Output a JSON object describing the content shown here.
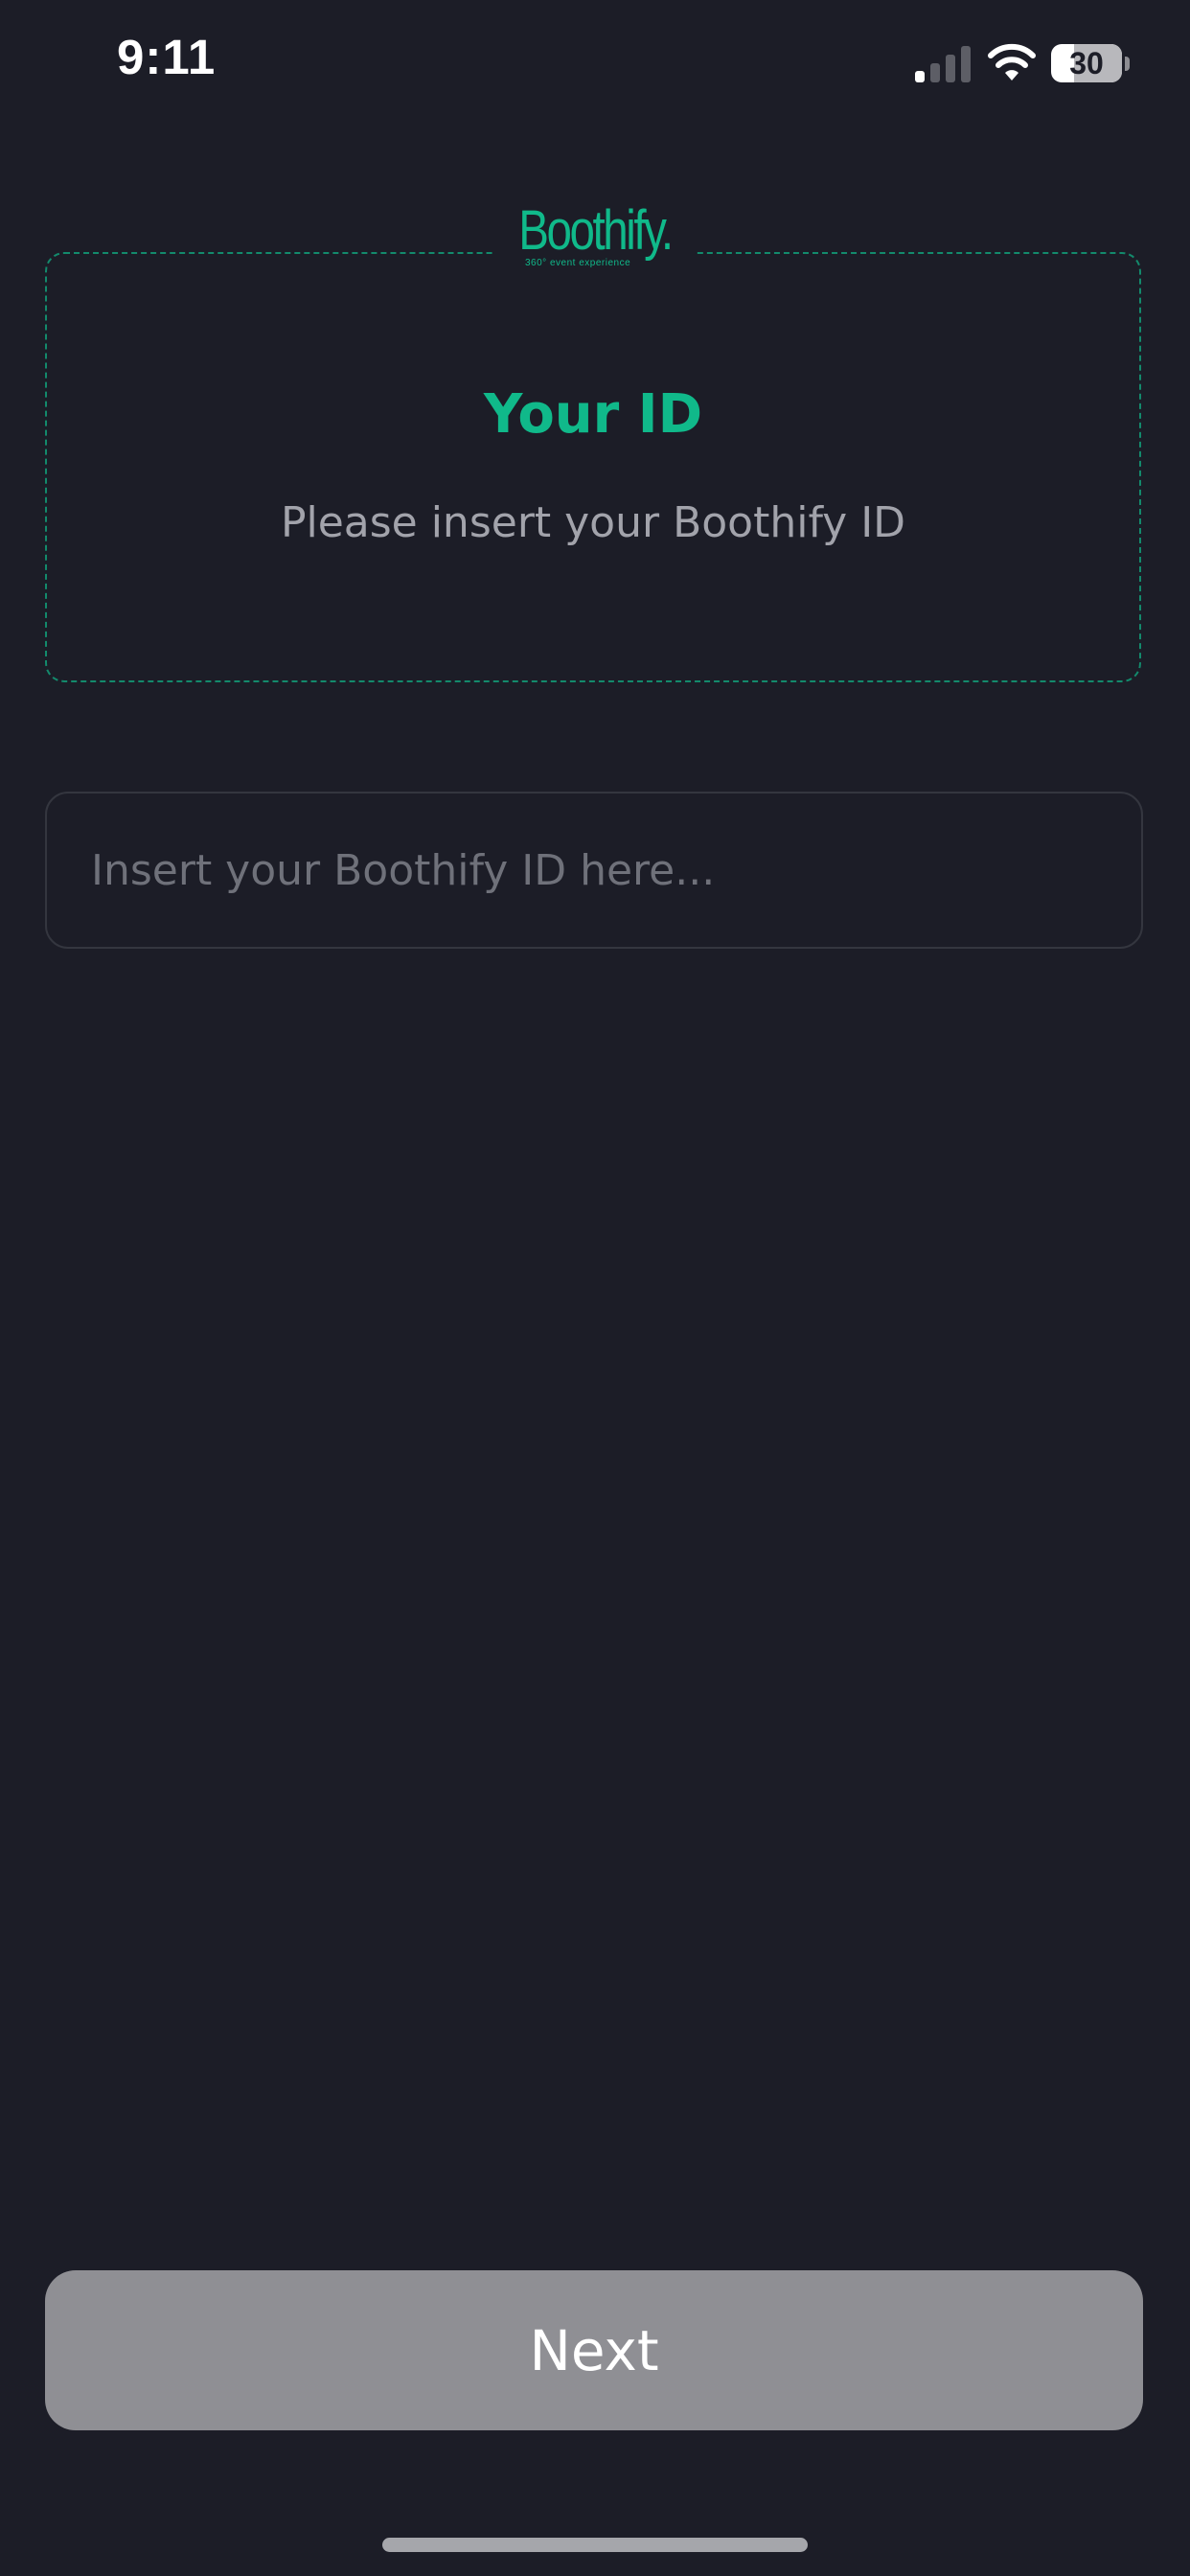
{
  "status_bar": {
    "time": "9:11",
    "battery_percent": "30",
    "battery_level": 0.3,
    "signal_bars_active": 1,
    "signal_bars_total": 4,
    "icons": [
      "signal-icon",
      "wifi-icon",
      "battery-icon"
    ]
  },
  "logo": {
    "text": "Boothify.",
    "tagline": "360° event experience"
  },
  "card": {
    "title": "Your ID",
    "subtitle": "Please insert your Boothify ID"
  },
  "id_input": {
    "value": "",
    "placeholder": "Insert your Boothify ID here..."
  },
  "next_button": {
    "label": "Next"
  },
  "colors": {
    "background": "#1c1d27",
    "accent": "#10b98a",
    "card_border": "#138a6c",
    "subtitle_text": "#a2a3ab",
    "button_disabled": "#8f8f94"
  }
}
